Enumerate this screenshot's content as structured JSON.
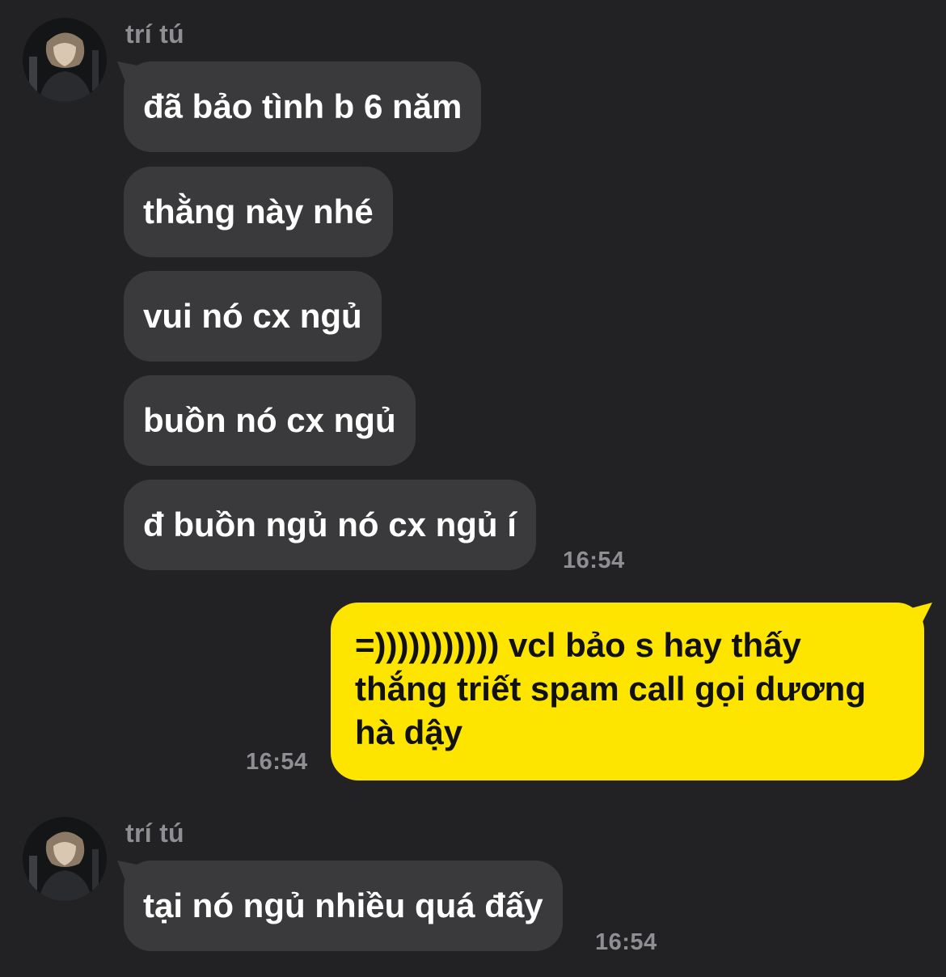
{
  "chat": {
    "sender_name": "trí tú",
    "group1": {
      "messages": [
        "đã bảo tình b 6 năm",
        "thằng này nhé",
        "vui nó cx ngủ",
        "buồn nó cx ngủ",
        "đ buồn ngủ nó cx ngủ í"
      ],
      "time": "16:54"
    },
    "my_message": {
      "text": "=))))))))))) vcl bảo s hay thấy thắng triết spam call gọi dương hà dậy",
      "time": "16:54"
    },
    "group2": {
      "messages": [
        "tại nó ngủ nhiều quá đấy"
      ],
      "time": "16:54"
    }
  },
  "colors": {
    "background": "#222224",
    "incoming_bubble": "#3a3a3c",
    "outgoing_bubble": "#fee500",
    "meta_text": "#8e8e93"
  },
  "icons": {
    "avatar": "profile-photo"
  }
}
